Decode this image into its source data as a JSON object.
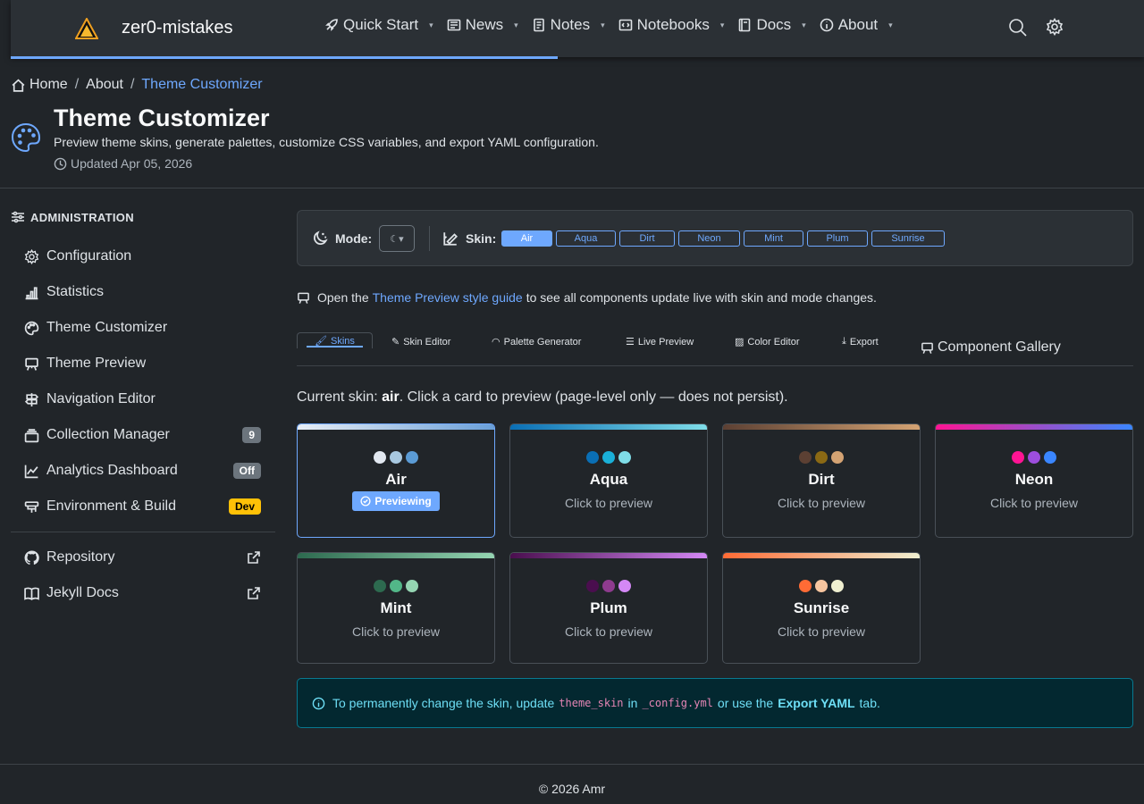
{
  "brand": {
    "name": "zer0-mistakes"
  },
  "nav": [
    {
      "label": "Quick Start",
      "icon": "rocket-icon"
    },
    {
      "label": "News",
      "icon": "newspaper-icon"
    },
    {
      "label": "Notes",
      "icon": "journal-icon"
    },
    {
      "label": "Notebooks",
      "icon": "code-file-icon"
    },
    {
      "label": "Docs",
      "icon": "book-icon"
    },
    {
      "label": "About",
      "icon": "info-icon"
    }
  ],
  "breadcrumb": {
    "home": "Home",
    "about": "About",
    "current": "Theme Customizer",
    "sep": "/"
  },
  "page": {
    "title": "Theme Customizer",
    "subtitle": "Preview theme skins, generate palettes, customize CSS variables, and export YAML configuration.",
    "updated": "Updated Apr 05, 2026"
  },
  "sidebar": {
    "heading": "ADMINISTRATION",
    "items": [
      {
        "label": "Configuration",
        "icon": "gear-icon",
        "badge": ""
      },
      {
        "label": "Statistics",
        "icon": "bar-chart-icon",
        "badge": ""
      },
      {
        "label": "Theme Customizer",
        "icon": "palette-icon",
        "badge": ""
      },
      {
        "label": "Theme Preview",
        "icon": "easel-icon",
        "badge": ""
      },
      {
        "label": "Navigation Editor",
        "icon": "signpost-icon",
        "badge": ""
      },
      {
        "label": "Collection Manager",
        "icon": "collection-icon",
        "badge": "9"
      },
      {
        "label": "Analytics Dashboard",
        "icon": "graph-icon",
        "badge": "Off"
      },
      {
        "label": "Environment & Build",
        "icon": "tools-icon",
        "badge": "Dev"
      }
    ],
    "external": [
      {
        "label": "Repository",
        "icon": "github-icon"
      },
      {
        "label": "Jekyll Docs",
        "icon": "book-icon"
      }
    ]
  },
  "toolbar": {
    "mode_label": "Mode:",
    "mode_value": "☾▾",
    "skin_label": "Skin:",
    "skins": [
      "Air",
      "Aqua",
      "Dirt",
      "Neon",
      "Mint",
      "Plum",
      "Sunrise"
    ],
    "active_skin": "Air"
  },
  "info": {
    "prefix": "Open the",
    "link": "Theme Preview style guide",
    "suffix": "to see all components update live with skin and mode changes."
  },
  "tabs": [
    {
      "label": "Skins",
      "icon": "brush-icon"
    },
    {
      "label": "Skin Editor",
      "icon": "pencil-icon"
    },
    {
      "label": "Palette Generator",
      "icon": "rainbow-icon"
    },
    {
      "label": "Live Preview",
      "icon": "sliders-icon"
    },
    {
      "label": "Color Editor",
      "icon": "palette-icon"
    },
    {
      "label": "Export",
      "icon": "download-icon"
    },
    {
      "label": "Component Gallery",
      "icon": "easel-icon"
    }
  ],
  "current": {
    "prefix": "Current skin:",
    "skin": "air",
    "suffix": ". Click a card to preview (page-level only — does not persist)."
  },
  "cards": [
    {
      "name": "Air",
      "hint": "Previewing",
      "colors": [
        "#e2e8f0",
        "#a8c8e0",
        "#5b9bd5"
      ],
      "bar": [
        "#e8eef5",
        "#6a9fd8"
      ]
    },
    {
      "name": "Aqua",
      "hint": "Click to preview",
      "colors": [
        "#0a6fb5",
        "#1ab0d8",
        "#7fdde8"
      ],
      "bar": [
        "#0a6fb5",
        "#7fdde8"
      ]
    },
    {
      "name": "Dirt",
      "hint": "Click to preview",
      "colors": [
        "#5c4033",
        "#8b6914",
        "#d4a373"
      ],
      "bar": [
        "#5c4033",
        "#d4a373"
      ]
    },
    {
      "name": "Neon",
      "hint": "Click to preview",
      "colors": [
        "#ff1493",
        "#9d4edd",
        "#3a86ff"
      ],
      "bar": [
        "#ff1493",
        "#3a86ff"
      ]
    },
    {
      "name": "Mint",
      "hint": "Click to preview",
      "colors": [
        "#2d6a4f",
        "#52b788",
        "#95d5b2"
      ],
      "bar": [
        "#2d6a4f",
        "#95d5b2"
      ]
    },
    {
      "name": "Plum",
      "hint": "Click to preview",
      "colors": [
        "#4a0e4e",
        "#8e3b8e",
        "#d488f5"
      ],
      "bar": [
        "#4a0e4e",
        "#d488f5"
      ]
    },
    {
      "name": "Sunrise",
      "hint": "Click to preview",
      "colors": [
        "#ff6b35",
        "#f7c59f",
        "#efefd0"
      ],
      "bar": [
        "#ff6b35",
        "#efefd0"
      ]
    }
  ],
  "alert": {
    "prefix": "To permanently change the skin, update",
    "code1": "theme_skin",
    "mid": "in",
    "code2": "_config.yml",
    "mid2": "or use the",
    "link": "Export YAML",
    "suffix": "tab."
  },
  "footer": "© 2026 Amr"
}
